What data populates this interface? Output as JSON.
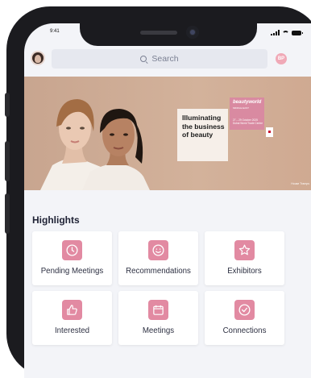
{
  "status_bar": {
    "time": "9:41"
  },
  "search": {
    "placeholder": "Search"
  },
  "profile": {
    "initials": "BP"
  },
  "banner": {
    "headline": "Illuminating the business of beauty",
    "brand": "beautyworld",
    "brand_sub": "MIDDLE EAST",
    "dates": "27 – 29 October 2025 Dubai World Trade Centre",
    "credit": "House Tramps"
  },
  "highlights": {
    "title": "Highlights",
    "tiles": [
      {
        "label": "Pending Meetings",
        "icon": "clock-icon"
      },
      {
        "label": "Recommendations",
        "icon": "smile-icon"
      },
      {
        "label": "Exhibitors",
        "icon": "star-icon"
      },
      {
        "label": "Interested",
        "icon": "thumbs-up-icon"
      },
      {
        "label": "Meetings",
        "icon": "calendar-icon"
      },
      {
        "label": "Connections",
        "icon": "check-circle-icon"
      }
    ]
  },
  "colors": {
    "accent": "#e28aa2",
    "banner_bg": "#c7a48d",
    "background": "#f3f4f8"
  }
}
